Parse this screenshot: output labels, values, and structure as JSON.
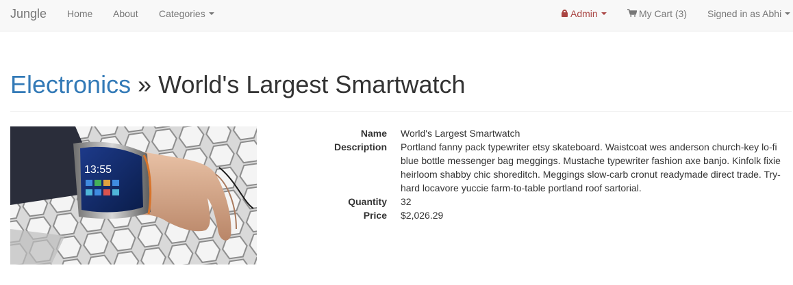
{
  "navbar": {
    "brand": "Jungle",
    "home": "Home",
    "about": "About",
    "categories": "Categories",
    "admin": "Admin",
    "cart": "My Cart (3)",
    "account": "Signed in as Abhi"
  },
  "header": {
    "category": "Electronics",
    "separator": "»",
    "product_name": "World's Largest Smartwatch"
  },
  "product": {
    "image_time": "13:55",
    "details": [
      {
        "label": "Name",
        "value": "World's Largest Smartwatch"
      },
      {
        "label": "Description",
        "value": "Portland fanny pack typewriter etsy skateboard. Waistcoat wes anderson church-key lo-fi blue bottle messenger bag meggings. Mustache typewriter fashion axe banjo. Kinfolk fixie heirloom shabby chic shoreditch. Meggings slow-carb cronut readymade direct trade. Try-hard locavore yuccie farm-to-table portland roof sartorial."
      },
      {
        "label": "Quantity",
        "value": "32"
      },
      {
        "label": "Price",
        "value": "$2,026.29"
      }
    ]
  },
  "colors": {
    "navbar_bg": "#f8f8f8",
    "link": "#337ab7",
    "admin": "#a94442",
    "text": "#333333",
    "nav_text": "#777777"
  }
}
